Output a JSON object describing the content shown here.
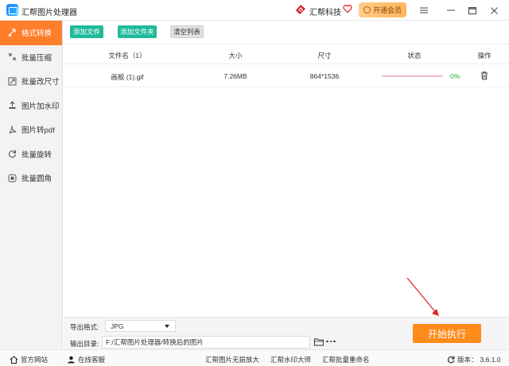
{
  "titlebar": {
    "app_title": "汇帮图片处理器",
    "brand_name": "汇帮科技",
    "vip_label": "开通会员",
    "icons": [
      "app-logo-icon",
      "brand-logo-icon",
      "heart-icon",
      "vip-icon",
      "menu-icon",
      "minimize-icon",
      "maximize-icon",
      "close-icon"
    ]
  },
  "sidebar": {
    "items": [
      {
        "label": "格式转换",
        "icon": "convert-icon",
        "active": true
      },
      {
        "label": "批量压缩",
        "icon": "compress-icon"
      },
      {
        "label": "批量改尺寸",
        "icon": "resize-icon"
      },
      {
        "label": "图片加水印",
        "icon": "watermark-icon"
      },
      {
        "label": "图片转pdf",
        "icon": "pdf-icon"
      },
      {
        "label": "批量旋转",
        "icon": "rotate-icon"
      },
      {
        "label": "批量圆角",
        "icon": "round-corner-icon"
      }
    ]
  },
  "toolbar": {
    "add_file": "添加文件",
    "add_folder": "添加文件夹",
    "clear_list": "清空列表"
  },
  "table": {
    "headers": {
      "name": "文件名（1）",
      "size": "大小",
      "dimensions": "尺寸",
      "status": "状态",
      "action": "操作"
    },
    "rows": [
      {
        "name": "画板 (1).gif",
        "size": "7.26MB",
        "dimensions": "864*1536",
        "progress": 0,
        "progress_text": "0%"
      }
    ]
  },
  "export": {
    "format_label": "导出格式:",
    "format_value": "JPG",
    "dir_label": "输出目录:",
    "dir_value": "F:/汇帮图片处理器/转换后的图片",
    "start_label": "开始执行"
  },
  "footer": {
    "website": "官方网站",
    "support": "在线客服",
    "link1": "汇帮图片无损放大",
    "link2": "汇帮水印大师",
    "link3": "汇帮批量重命名",
    "version_label": "版本：",
    "version_value": "3.6.1.0"
  },
  "colors": {
    "accent": "#ff7e2c",
    "green_button": "#1fb99a",
    "start_button": "#ff8b1a",
    "progress": "#e8577a",
    "percent_text": "#1fb53a"
  }
}
